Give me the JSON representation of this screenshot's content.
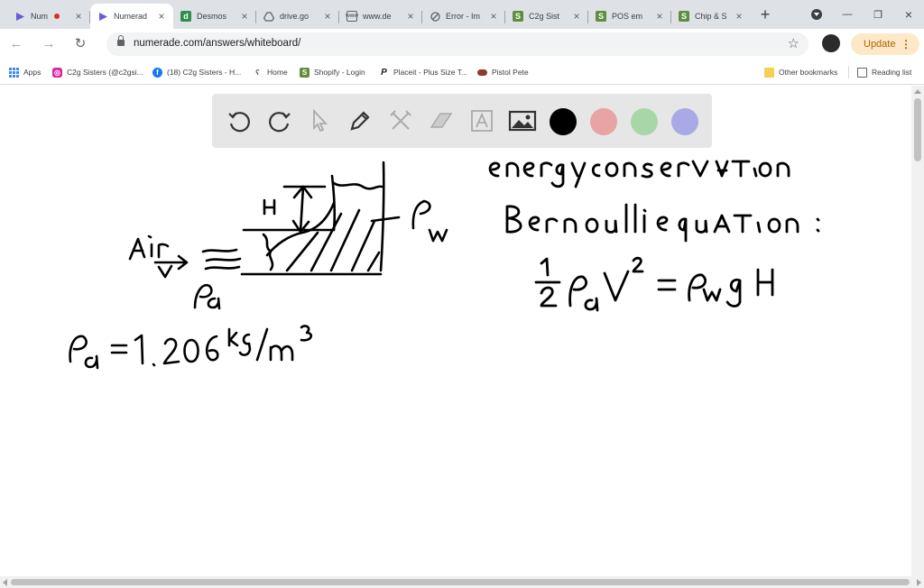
{
  "tabs": [
    {
      "title": "Num",
      "favicon": "numerade-icon",
      "recording": true
    },
    {
      "title": "Numerad",
      "favicon": "numerade-icon",
      "active": true
    },
    {
      "title": "Desmos",
      "favicon": "desmos-icon"
    },
    {
      "title": "drive.go",
      "favicon": "drive-icon"
    },
    {
      "title": "www.de",
      "favicon": "globe-icon"
    },
    {
      "title": "Error - Im",
      "favicon": "error-icon"
    },
    {
      "title": "C2g Sist",
      "favicon": "shopify-icon"
    },
    {
      "title": "POS em",
      "favicon": "shopify-icon"
    },
    {
      "title": "Chip & S",
      "favicon": "shopify-icon"
    }
  ],
  "address": {
    "url": "numerade.com/answers/whiteboard/"
  },
  "update_label": "Update",
  "bookmarks": [
    {
      "label": "Apps",
      "icon": "apps-grid-icon"
    },
    {
      "label": "C2g Sisters (@c2gsi...",
      "icon": "instagram-icon"
    },
    {
      "label": "(18) C2g Sisters - H...",
      "icon": "facebook-icon"
    },
    {
      "label": "Home",
      "icon": "home-icon"
    },
    {
      "label": "Shopify - Login",
      "icon": "shopify-icon"
    },
    {
      "label": "Placeit - Plus Size T...",
      "icon": "placeit-icon"
    },
    {
      "label": "Pistol Pete",
      "icon": "pistol-icon"
    }
  ],
  "other_bookmarks": "Other bookmarks",
  "reading_list": "Reading list",
  "whiteboard": {
    "tools": [
      "undo-icon",
      "redo-icon",
      "pointer-icon",
      "pen-icon",
      "tools-icon",
      "eraser-icon",
      "text-icon",
      "image-icon"
    ],
    "colors": [
      "#000000",
      "#e8a3a3",
      "#a9d6a9",
      "#a9a9e6"
    ]
  }
}
